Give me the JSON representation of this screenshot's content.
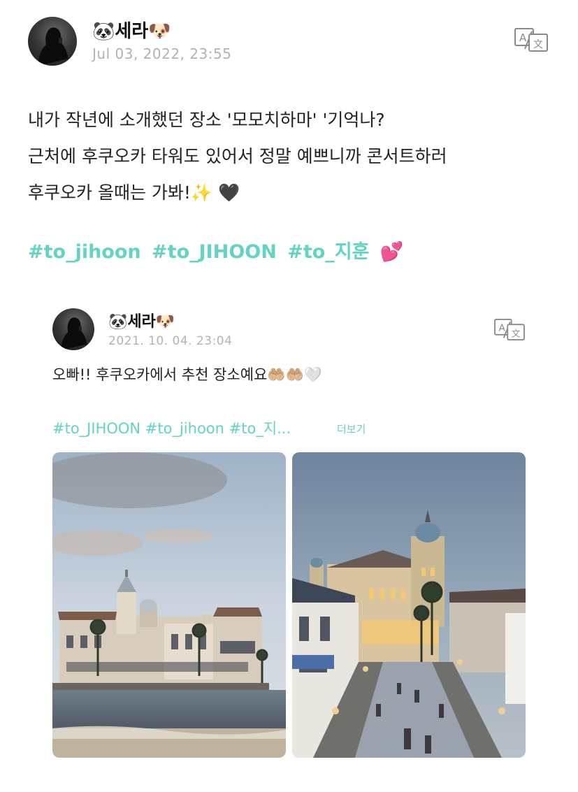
{
  "post": {
    "author_name": "🐼세라🐶",
    "timestamp": "Jul 03, 2022, 23:55",
    "text_lines": [
      "내가 작년에 소개했던 장소 '모모치하마' '기억나?",
      "근처에 후쿠오카 타워도 있어서 정말 예쁘니까 콘서트하러",
      "후쿠오카 올때는 가봐!✨ 🖤"
    ],
    "hashtags": [
      "#to_jihoon",
      "#to_JIHOON",
      "#to_지훈",
      "💕"
    ],
    "icons": {
      "avatar": "profile-avatar",
      "translate": "translate-icon"
    }
  },
  "quoted_post": {
    "author_name": "🐼세라🐶",
    "timestamp": "2021. 10. 04. 23:04",
    "text": "오빠!! 후쿠오카에서 추천 장소예요🤲🏼🤲🏼🤍",
    "hashtags_preview": "#to_JIHOON #to_jihoon #to_지...",
    "more_label": "더보기",
    "photos": [
      "seaside-building-photo",
      "illuminated-promenade-photo"
    ]
  },
  "colors": {
    "accent": "#63d3c3",
    "timestamp": "#b2b2b2",
    "text": "#222222"
  }
}
